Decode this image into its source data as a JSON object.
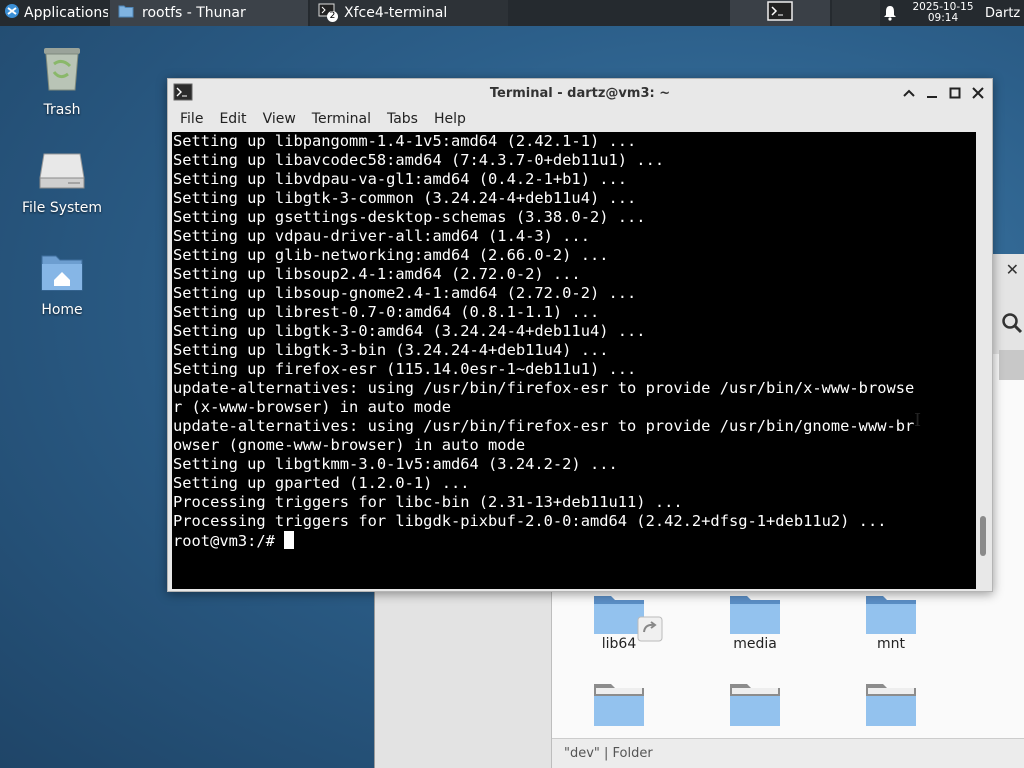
{
  "panel": {
    "applications_label": "Applications",
    "tasks": [
      {
        "label": "rootfs - Thunar",
        "icon": "folder-icon"
      },
      {
        "label": "Xfce4-terminal",
        "icon": "terminal-icon",
        "badge": "2"
      }
    ],
    "clock_date": "2025-10-15",
    "clock_time": "09:14",
    "user": "Dartz"
  },
  "desktop": {
    "icons": [
      {
        "label": "Trash",
        "icon": "trash-icon"
      },
      {
        "label": "File System",
        "icon": "drive-icon"
      },
      {
        "label": "Home",
        "icon": "home-folder-icon"
      }
    ]
  },
  "thunar": {
    "folders": [
      "lib64",
      "media",
      "mnt"
    ],
    "status_text": "\"dev\"  |  Folder"
  },
  "terminal": {
    "title": "Terminal - dartz@vm3: ~",
    "menu": [
      "File",
      "Edit",
      "View",
      "Terminal",
      "Tabs",
      "Help"
    ],
    "lines": [
      "Setting up libpangomm-1.4-1v5:amd64 (2.42.1-1) ...",
      "Setting up libavcodec58:amd64 (7:4.3.7-0+deb11u1) ...",
      "Setting up libvdpau-va-gl1:amd64 (0.4.2-1+b1) ...",
      "Setting up libgtk-3-common (3.24.24-4+deb11u4) ...",
      "Setting up gsettings-desktop-schemas (3.38.0-2) ...",
      "Setting up vdpau-driver-all:amd64 (1.4-3) ...",
      "Setting up glib-networking:amd64 (2.66.0-2) ...",
      "Setting up libsoup2.4-1:amd64 (2.72.0-2) ...",
      "Setting up libsoup-gnome2.4-1:amd64 (2.72.0-2) ...",
      "Setting up librest-0.7-0:amd64 (0.8.1-1.1) ...",
      "Setting up libgtk-3-0:amd64 (3.24.24-4+deb11u4) ...",
      "Setting up libgtk-3-bin (3.24.24-4+deb11u4) ...",
      "Setting up firefox-esr (115.14.0esr-1~deb11u1) ...",
      "update-alternatives: using /usr/bin/firefox-esr to provide /usr/bin/x-www-browse",
      "r (x-www-browser) in auto mode",
      "update-alternatives: using /usr/bin/firefox-esr to provide /usr/bin/gnome-www-br",
      "owser (gnome-www-browser) in auto mode",
      "Setting up libgtkmm-3.0-1v5:amd64 (3.24.2-2) ...",
      "Setting up gparted (1.2.0-1) ...",
      "Processing triggers for libc-bin (2.31-13+deb11u11) ...",
      "Processing triggers for libgdk-pixbuf-2.0-0:amd64 (2.42.2+dfsg-1+deb11u2) ..."
    ],
    "prompt": "root@vm3:/# ",
    "scroll_position": 0.92
  }
}
